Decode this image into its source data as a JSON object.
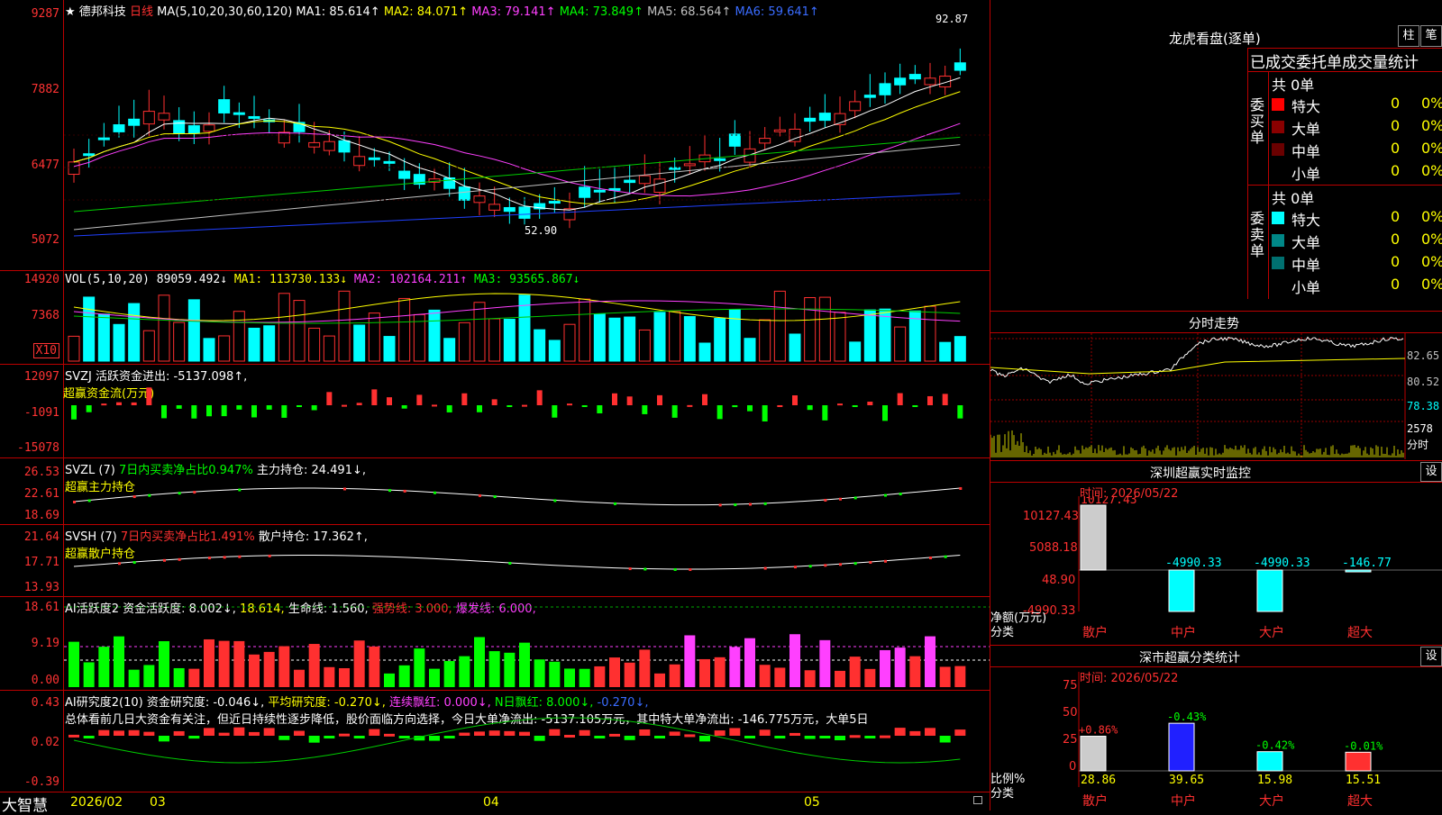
{
  "colors": {
    "up": "#ff3030",
    "down": "#00ffff",
    "ma1": "#ffffff",
    "ma2": "#ffff00",
    "ma3": "#ff40ff",
    "ma4": "#00cc00",
    "ma5": "#c0c0c0",
    "ma6": "#2040ff",
    "grid": "#b00000"
  },
  "main": {
    "star": "★",
    "stock_name": "德邦科技",
    "period": "日线",
    "ma_label": "MA(5,10,20,30,60,120)",
    "ma1": "MA1: 85.614↑",
    "ma2": "MA2: 84.071↑",
    "ma3": "MA3: 79.141↑",
    "ma4": "MA4: 73.849↑",
    "ma5": "MA5: 68.564↑",
    "ma6": "MA6: 59.641↑",
    "y_ticks": [
      "9287",
      "7882",
      "6477",
      "5072"
    ],
    "high_label": "92.87",
    "low_label": "52.90"
  },
  "vol": {
    "label": "VOL(5,10,20)",
    "value": "89059.492↓",
    "ma1": "MA1: 113730.133↓",
    "ma2": "MA2: 102164.211↑",
    "ma3": "MA3: 93565.867↓",
    "y_ticks": [
      "14920",
      "7368"
    ],
    "unit": "X10"
  },
  "svzj": {
    "label": "SVZJ",
    "desc": "活跃资金进出: -5137.098↑,",
    "sub": "超赢资金流(万元)",
    "y_ticks": [
      "12097",
      "-1091",
      "-15078"
    ]
  },
  "svzl": {
    "label": "SVZL (7)",
    "desc": "7日内买卖净占比0.947%",
    "hold": "主力持仓: 24.491↓,",
    "sub": "超赢主力持仓",
    "y_ticks": [
      "26.53",
      "22.61",
      "18.69"
    ]
  },
  "svsh": {
    "label": "SVSH (7)",
    "desc": "7日内买卖净占比1.491%",
    "hold": "散户持仓: 17.362↑,",
    "sub": "超赢散户持仓",
    "y_ticks": [
      "21.64",
      "17.71",
      "13.93"
    ]
  },
  "ai1": {
    "label": "AI活跃度2",
    "v1": "资金活跃度: 8.002↓,",
    "v2": "18.614,",
    "v3": "生命线: 1.560,",
    "v4": "强势线: 3.000,",
    "v5": "爆发线: 6.000,",
    "y_ticks": [
      "18.61",
      "9.19",
      "0.00"
    ]
  },
  "ai2": {
    "label": "AI研究度2(10)",
    "v1": "资金研究度: -0.046↓,",
    "v2": "平均研究度: -0.270↓,",
    "v3": "连续飘红: 0.000↓,",
    "v4": "N日飘红: 8.000↓,",
    "v5": "-0.270↓,",
    "summary": "总体看前几日大资金有关注，但近日持续性逐步降低，股价面临方向选择，今日大单净流出: -5137.105万元，其中特大单净流出: -146.775万元，大单5日",
    "y_ticks": [
      "0.43",
      "0.02",
      "-0.39"
    ]
  },
  "bottom": {
    "brand": "大智慧",
    "d1": "2026/02",
    "d2": "03",
    "d3": "04",
    "d4": "05"
  },
  "lhb": {
    "title": "龙虎看盘(逐单)",
    "btn1": "柱",
    "btn2": "笔",
    "header": "已成交委托单成交量统计",
    "buy": {
      "side": "委买单",
      "total": "共 0单",
      "rows": [
        {
          "name": "特大",
          "n": "0",
          "p": "0%",
          "c": "#ff0000"
        },
        {
          "name": "大单",
          "n": "0",
          "p": "0%",
          "c": "#8a0000"
        },
        {
          "name": "中单",
          "n": "0",
          "p": "0%",
          "c": "#6a0000"
        },
        {
          "name": "小单",
          "n": "0",
          "p": "0%",
          "c": "#000000"
        }
      ]
    },
    "sell": {
      "side": "委卖单",
      "total": "共 0单",
      "rows": [
        {
          "name": "特大",
          "n": "0",
          "p": "0%",
          "c": "#00ffff"
        },
        {
          "name": "大单",
          "n": "0",
          "p": "0%",
          "c": "#008888"
        },
        {
          "name": "中单",
          "n": "0",
          "p": "0%",
          "c": "#007070"
        },
        {
          "name": "小单",
          "n": "0",
          "p": "0%",
          "c": "#000000"
        }
      ]
    }
  },
  "fenshi": {
    "title": "分时走势",
    "y_ticks": [
      "82.65",
      "80.52",
      "78.38",
      "2578",
      "分时"
    ]
  },
  "sz": {
    "title": "深圳超赢实时监控",
    "btn": "设",
    "time": "时间: 2026/05/22",
    "y_ticks": [
      "10127.43",
      "5088.18",
      "48.90",
      "-4990.33"
    ],
    "unit": "净额(万元)",
    "unit2": "分类",
    "bars": [
      {
        "cat": "散户",
        "val": 10127.43,
        "label": "10127.43"
      },
      {
        "cat": "中户",
        "val": -4990.33,
        "label": "-4990.33"
      },
      {
        "cat": "大户",
        "val": -4990.33,
        "label": "-4990.33"
      },
      {
        "cat": "超大",
        "val": -146.77,
        "label": "-146.77"
      }
    ]
  },
  "fl": {
    "title": "深市超赢分类统计",
    "btn": "设",
    "time": "时间: 2026/05/22",
    "y_ticks": [
      "75",
      "50",
      "25",
      "0"
    ],
    "unit": "比例%",
    "unit2": "分类",
    "bars": [
      {
        "cat": "散户",
        "val": 28.86,
        "delta": "+0.86%",
        "c": "#cccccc",
        "dc": "#ff3030"
      },
      {
        "cat": "中户",
        "val": 39.65,
        "delta": "-0.43%",
        "c": "#2020ff",
        "dc": "#00ff00"
      },
      {
        "cat": "大户",
        "val": 15.98,
        "delta": "-0.42%",
        "c": "#00ffff",
        "dc": "#00ff00"
      },
      {
        "cat": "超大",
        "val": 15.51,
        "delta": "-0.01%",
        "c": "#ff3030",
        "dc": "#00ff00"
      }
    ]
  }
}
